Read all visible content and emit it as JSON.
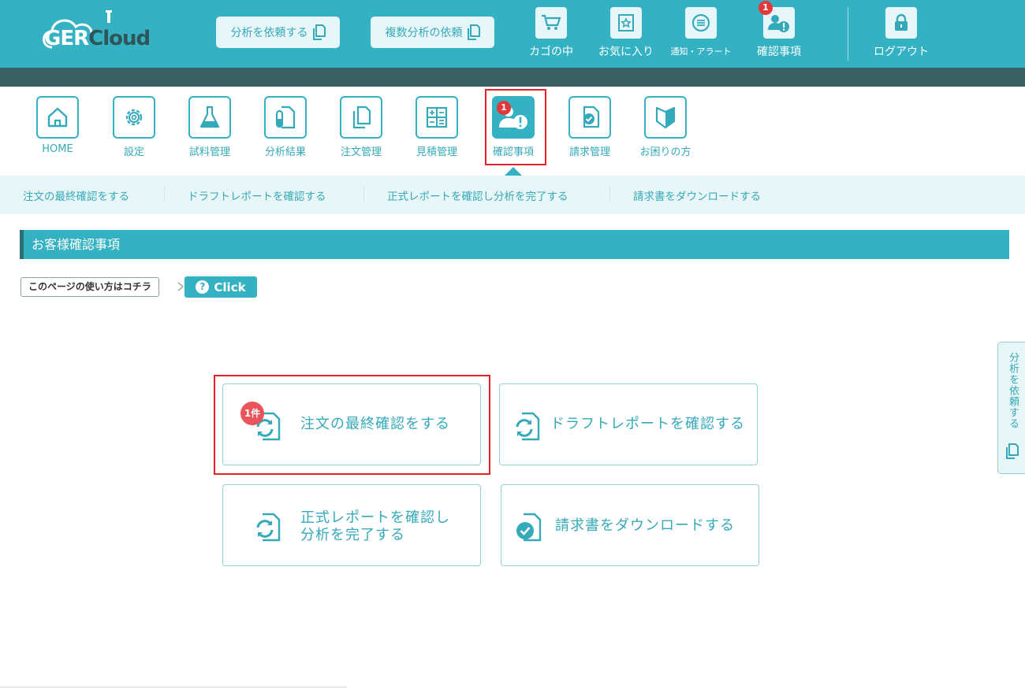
{
  "header": {
    "logo": {
      "text_ger": "GER",
      "text_cloud": "Cloud"
    },
    "buttons": [
      {
        "label": "分析を依頼する"
      },
      {
        "label": "複数分析の依頼"
      }
    ],
    "items": [
      {
        "label": "カゴの中",
        "icon": "cart-icon"
      },
      {
        "label": "お気に入り",
        "icon": "favorite-icon"
      },
      {
        "label": "通知・アラート",
        "icon": "notification-icon"
      },
      {
        "label": "確認事項",
        "icon": "confirm-user-icon",
        "badge": "1"
      },
      {
        "label": "ログアウト",
        "icon": "lock-icon"
      }
    ]
  },
  "nav": {
    "items": [
      {
        "label": "HOME",
        "icon": "home-icon"
      },
      {
        "label": "設定",
        "icon": "gear-icon"
      },
      {
        "label": "試料管理",
        "icon": "flask-icon"
      },
      {
        "label": "分析結果",
        "icon": "test-tube-doc-icon"
      },
      {
        "label": "注文管理",
        "icon": "copy-docs-icon"
      },
      {
        "label": "見積管理",
        "icon": "calculator-icon"
      },
      {
        "label": "確認事項",
        "icon": "confirm-user-icon",
        "badge": "1",
        "active": true
      },
      {
        "label": "請求管理",
        "icon": "invoice-check-icon"
      },
      {
        "label": "お困りの方",
        "icon": "beginner-mark-icon"
      }
    ]
  },
  "subnav": {
    "items": [
      {
        "label": "注文の最終確認をする"
      },
      {
        "label": "ドラフトレポートを確認する"
      },
      {
        "label": "正式レポートを確認し分析を完了する"
      },
      {
        "label": "請求書をダウンロードする"
      }
    ]
  },
  "section": {
    "title": "お客様確認事項"
  },
  "help": {
    "text": "このページの使い方はコチラ",
    "button": "Click"
  },
  "cards": [
    {
      "line1": "注文の最終確認をする",
      "line2": "",
      "badge": "1件",
      "icon": "refresh-doc-icon"
    },
    {
      "line1": "ドラフトレポートを確認する",
      "line2": "",
      "icon": "refresh-doc-icon"
    },
    {
      "line1": "正式レポートを確認し",
      "line2": "分析を完了する",
      "icon": "refresh-doc-icon"
    },
    {
      "line1": "請求書をダウンロードする",
      "line2": "",
      "icon": "check-doc-icon"
    }
  ],
  "side_tab": {
    "label": "分析を依頼する"
  },
  "colors": {
    "primary": "#34b1c2",
    "dark": "#3a5f62",
    "alert": "#e5383b",
    "light_bg": "#e8f6f7"
  }
}
